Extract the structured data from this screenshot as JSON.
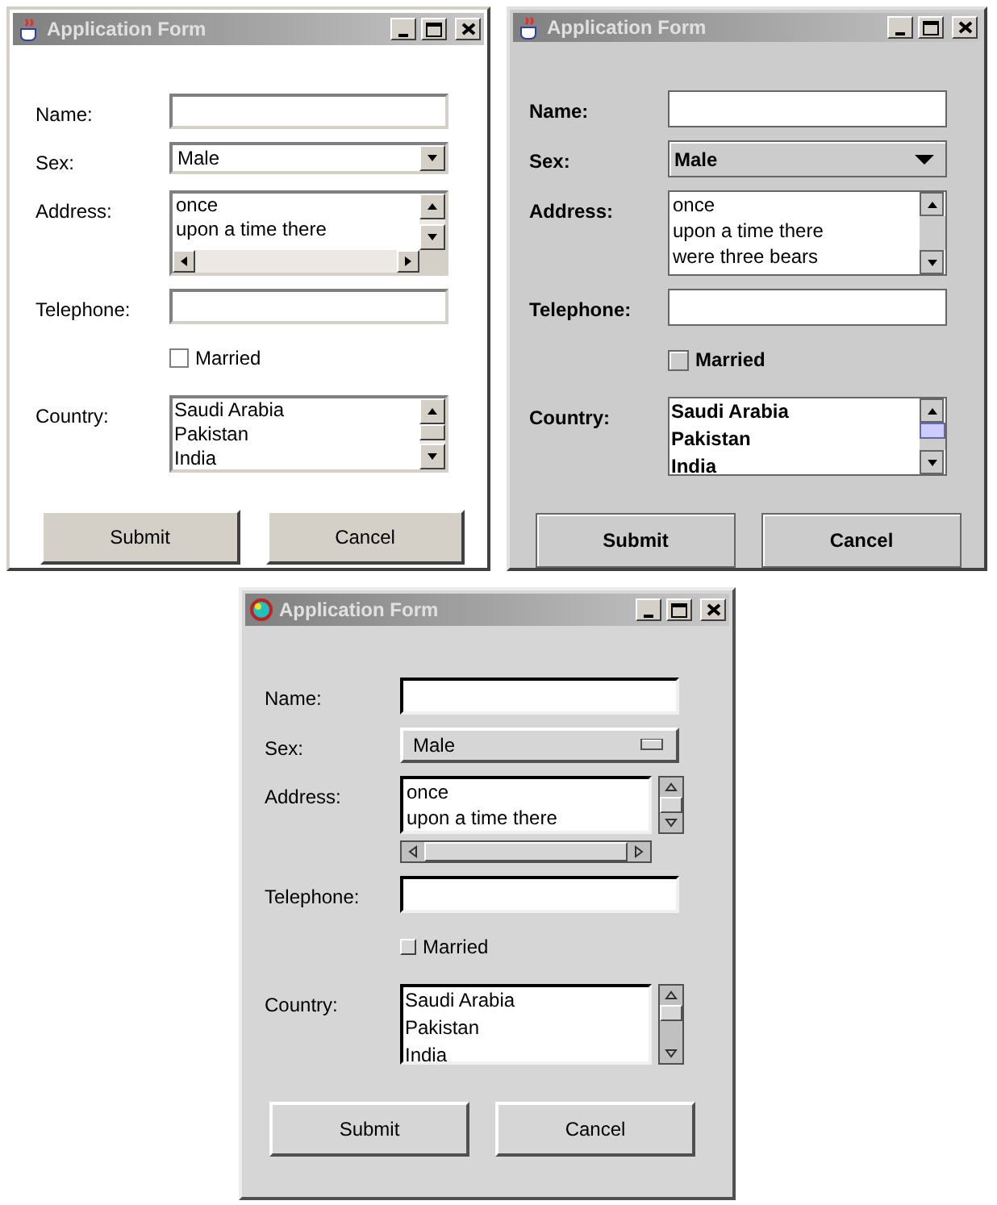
{
  "windows": [
    {
      "kind": "windows",
      "title": "Application Form",
      "fields": [
        {
          "kind": "text",
          "label": "Name:"
        },
        {
          "kind": "dropdown",
          "label": "Sex:",
          "value": "Male"
        },
        {
          "kind": "textarea",
          "label": "Address:",
          "lines": [
            "once",
            "upon a time there"
          ]
        },
        {
          "kind": "text",
          "label": "Telephone:"
        },
        {
          "kind": "checkbox",
          "label": "Married",
          "checked": false
        },
        {
          "kind": "list",
          "label": "Country:",
          "items": [
            "Saudi Arabia",
            "Pakistan",
            "India"
          ]
        }
      ],
      "buttons": [
        "Submit",
        "Cancel"
      ]
    },
    {
      "kind": "metal",
      "title": "Application Form",
      "fields": [
        {
          "kind": "text",
          "label": "Name:"
        },
        {
          "kind": "dropdown",
          "label": "Sex:",
          "value": "Male"
        },
        {
          "kind": "textarea",
          "label": "Address:",
          "lines": [
            "once",
            "upon a time there",
            "were three bears"
          ]
        },
        {
          "kind": "text",
          "label": "Telephone:"
        },
        {
          "kind": "checkbox",
          "label": "Married",
          "checked": false
        },
        {
          "kind": "list",
          "label": "Country:",
          "items": [
            "Saudi Arabia",
            "Pakistan",
            "India"
          ]
        }
      ],
      "buttons": [
        "Submit",
        "Cancel"
      ]
    },
    {
      "kind": "motif",
      "title": "Application Form",
      "fields": [
        {
          "kind": "text",
          "label": "Name:"
        },
        {
          "kind": "dropdown",
          "label": "Sex:",
          "value": "Male"
        },
        {
          "kind": "textarea",
          "label": "Address:",
          "lines": [
            "once",
            "upon a time there"
          ]
        },
        {
          "kind": "text",
          "label": "Telephone:"
        },
        {
          "kind": "checkbox",
          "label": "Married",
          "checked": false
        },
        {
          "kind": "list",
          "label": "Country:",
          "items": [
            "Saudi Arabia",
            "Pakistan",
            "India"
          ]
        }
      ],
      "buttons": [
        "Submit",
        "Cancel"
      ]
    }
  ]
}
